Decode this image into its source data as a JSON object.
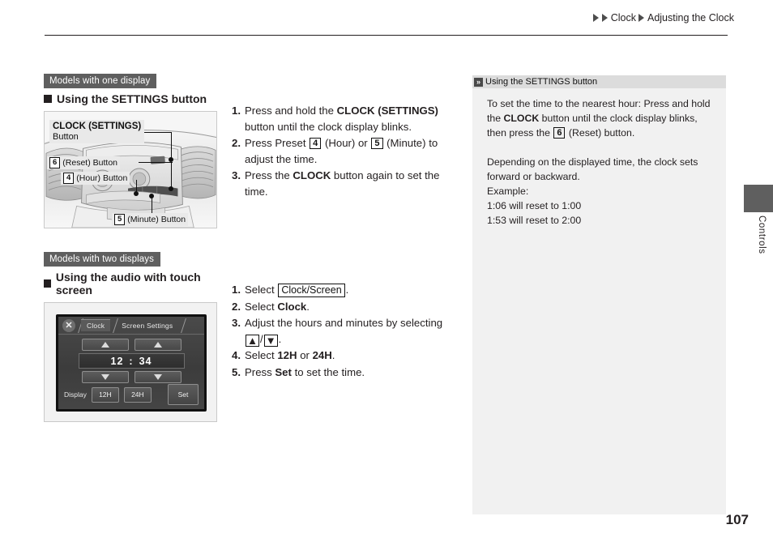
{
  "header": {
    "breadcrumb": [
      {
        "label": "Clock"
      },
      {
        "label": "Adjusting the Clock"
      }
    ]
  },
  "section_one": {
    "model_badge": "Models with one display",
    "heading": "Using the SETTINGS button",
    "figure": {
      "callouts": [
        {
          "name": "clock-settings",
          "title": "CLOCK (SETTINGS)",
          "subtitle": "Button"
        },
        {
          "name": "reset",
          "num": "6",
          "label": "(Reset) Button"
        },
        {
          "name": "hour",
          "num": "4",
          "label": "(Hour) Button"
        },
        {
          "name": "minute",
          "num": "5",
          "label": "(Minute) Button"
        }
      ]
    },
    "steps": [
      {
        "num": "1.",
        "parts": [
          {
            "t": "Press and hold the "
          },
          {
            "t": "CLOCK (SETTINGS)",
            "b": true
          },
          {
            "t": " button until the clock display blinks."
          }
        ]
      },
      {
        "num": "2.",
        "parts": [
          {
            "t": "Press Preset "
          },
          {
            "t": "4",
            "box": true
          },
          {
            "t": " (Hour) or "
          },
          {
            "t": "5",
            "box": true
          },
          {
            "t": " (Minute) to adjust the time."
          }
        ]
      },
      {
        "num": "3.",
        "parts": [
          {
            "t": "Press the "
          },
          {
            "t": "CLOCK",
            "b": true
          },
          {
            "t": " button again to set the time."
          }
        ]
      }
    ]
  },
  "section_two": {
    "model_badge": "Models with two displays",
    "heading": "Using the audio with touch screen",
    "touch_screen": {
      "close_icon": "close-icon",
      "tabs": [
        {
          "label": "Clock",
          "active": true
        },
        {
          "label": "Screen Settings",
          "active": false
        }
      ],
      "hour_up": "up-arrow-icon",
      "minute_up": "up-arrow-icon",
      "hour_down": "down-arrow-icon",
      "minute_down": "down-arrow-icon",
      "time": {
        "hours": "12",
        "separator": ":",
        "minutes": "34"
      },
      "display_label": "Display",
      "format_buttons": [
        {
          "label": "12H"
        },
        {
          "label": "24H"
        }
      ],
      "set_button": "Set"
    },
    "steps": [
      {
        "num": "1.",
        "parts": [
          {
            "t": "Select "
          },
          {
            "t": "Clock/Screen",
            "kbox": true
          },
          {
            "t": "."
          }
        ]
      },
      {
        "num": "2.",
        "parts": [
          {
            "t": "Select "
          },
          {
            "t": "Clock",
            "b": true
          },
          {
            "t": "."
          }
        ]
      },
      {
        "num": "3.",
        "parts": [
          {
            "t": "Adjust the hours and minutes by selecting "
          },
          {
            "t": "▲",
            "abox": true
          },
          {
            "t": "/"
          },
          {
            "t": "▼",
            "abox": true
          },
          {
            "t": "."
          }
        ]
      },
      {
        "num": "4.",
        "parts": [
          {
            "t": "Select "
          },
          {
            "t": "12H",
            "b": true
          },
          {
            "t": " or "
          },
          {
            "t": "24H",
            "b": true
          },
          {
            "t": "."
          }
        ]
      },
      {
        "num": "5.",
        "parts": [
          {
            "t": "Press "
          },
          {
            "t": "Set",
            "b": true
          },
          {
            "t": " to set the time."
          }
        ]
      }
    ]
  },
  "note_panel": {
    "icon": "double-chevron-icon",
    "title": "Using the SETTINGS button",
    "paragraph_one": [
      {
        "t": "To set the time to the nearest hour: Press and hold the "
      },
      {
        "t": "CLOCK",
        "b": true
      },
      {
        "t": " button until the clock display blinks, then press the "
      },
      {
        "t": "6",
        "box": true
      },
      {
        "t": " (Reset) button."
      }
    ],
    "paragraph_two_lines": [
      "Depending on the displayed time, the clock sets forward or backward.",
      "Example:",
      "1:06 will reset to 1:00",
      "1:53 will reset to 2:00"
    ]
  },
  "chapter_tab": {
    "label": "Controls"
  },
  "page_number": "107",
  "colors": {
    "badge_bg": "#5f5f5f",
    "note_bg": "#f1f1f1",
    "note_head_bg": "#dcdcdc",
    "ink": "#231f20",
    "figure_bg": "#f2f2f2"
  }
}
